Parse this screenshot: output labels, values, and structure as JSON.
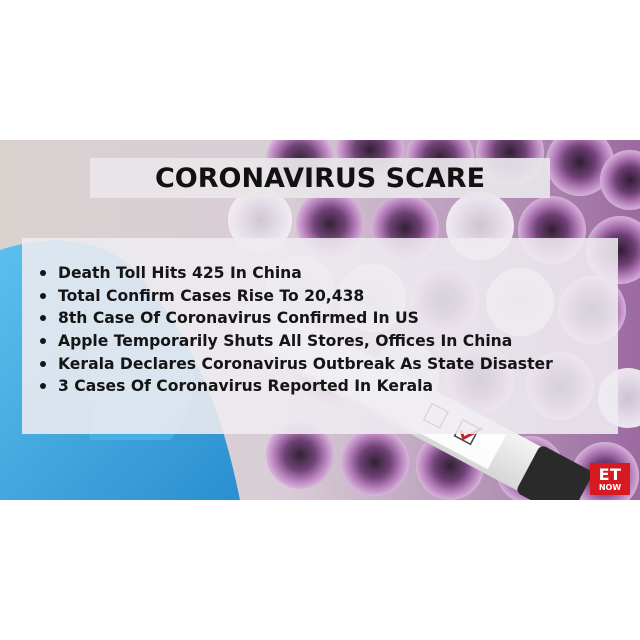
{
  "title": "CORONAVIRUS SCARE",
  "bullets": [
    "Death Toll Hits 425 In China",
    "Total Confirm Cases Rise To 20,438",
    "8th Case Of Coronavirus Confirmed In US",
    "Apple Temporarily Shuts All Stores, Offices In China",
    "Kerala Declares Coronavirus Outbreak As State Disaster",
    "3 Cases Of Coronavirus Reported In Kerala"
  ],
  "logo": {
    "top": "ET",
    "bottom": "NOW"
  },
  "colors": {
    "logo_red": "#d71920",
    "glove_blue": "#3fa8e0",
    "tube_purple": "#a05aa8",
    "text": "#151515"
  }
}
